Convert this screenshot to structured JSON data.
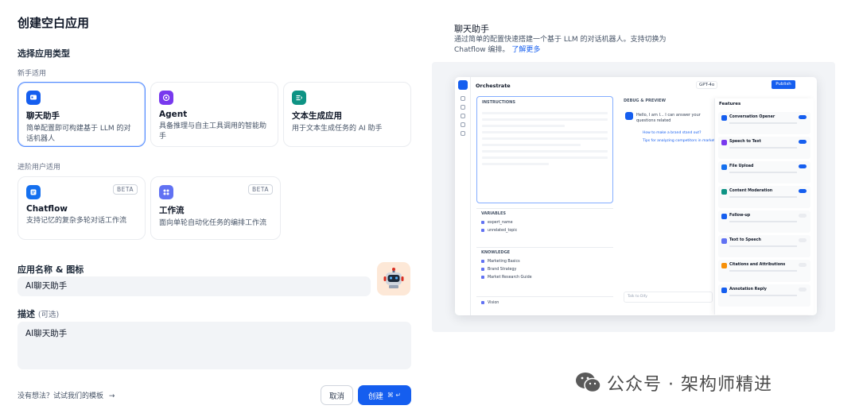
{
  "page": {
    "title": "创建空白应用"
  },
  "app_type": {
    "section_title": "选择应用类型",
    "beginner_label": "新手适用",
    "advanced_label": "进阶用户适用",
    "beginner_cards": [
      {
        "title": "聊天助手",
        "desc": "简单配置即可构建基于 LLM 的对话机器人",
        "color": "#155eef",
        "icon": "chat-bubble-icon",
        "selected": true
      },
      {
        "title": "Agent",
        "desc": "具备推理与自主工具调用的智能助手",
        "color": "#7839ee",
        "icon": "robot-icon",
        "selected": false
      },
      {
        "title": "文本生成应用",
        "desc": "用于文本生成任务的 AI 助手",
        "color": "#0e9384",
        "icon": "text-generate-icon",
        "selected": false
      }
    ],
    "advanced_cards": [
      {
        "title": "Chatflow",
        "desc": "支持记忆的复杂多轮对话工作流",
        "badge": "BETA",
        "color": "#1570ef",
        "icon": "chatflow-icon"
      },
      {
        "title": "工作流",
        "desc": "面向单轮自动化任务的编排工作流",
        "badge": "BETA",
        "color": "#6172f3",
        "icon": "workflow-icon"
      }
    ]
  },
  "form": {
    "name_label": "应用名称 & 图标",
    "name_value": "AI聊天助手",
    "desc_label": "描述",
    "desc_optional": "(可选)",
    "desc_value": "AI聊天助手"
  },
  "footer": {
    "hint": "没有想法？试试我们的模板",
    "hint_arrow": "→",
    "cancel_label": "取消",
    "create_label": "创建",
    "create_shortcut": "⌘ ↵"
  },
  "preview": {
    "title": "聊天助手",
    "desc": "通过简单的配置快速搭建一个基于 LLM 的对话机器人。支持切换为 Chatflow 编排。",
    "learn_more": "了解更多",
    "window": {
      "title": "Orchestrate",
      "model": "GPT-4o",
      "publish": "Publish",
      "instructions": "INSTRUCTIONS",
      "debug": "DEBUG & PREVIEW",
      "variables": "VARIABLES",
      "knowledge": "KNOWLEDGE",
      "variable_rows": [
        "expert_name",
        "unrelated_topic"
      ],
      "knowledge_rows": [
        "Marketing Basics",
        "Brand Strategy",
        "Market Research Guide"
      ],
      "vision": "Vision",
      "chat_greeting": "Hello, I am I...\nI can answer your questions related",
      "suggestions": [
        "How to make a brand stand out?",
        "Tips for analyzing competitors in market"
      ],
      "chat_placeholder": "Talk to Dify",
      "features_title": "Features",
      "features": [
        {
          "name": "Conversation Opener",
          "on": true,
          "color": "#155eef"
        },
        {
          "name": "Speech to Text",
          "on": true,
          "color": "#7839ee"
        },
        {
          "name": "File Upload",
          "on": true,
          "color": "#1570ef"
        },
        {
          "name": "Content Moderation",
          "on": true,
          "color": "#0e9384"
        },
        {
          "name": "Follow-up",
          "on": false,
          "color": "#155eef"
        },
        {
          "name": "Text to Speech",
          "on": false,
          "color": "#6172f3"
        },
        {
          "name": "Citations and Attributions",
          "on": false,
          "color": "#f79009"
        },
        {
          "name": "Annotation Reply",
          "on": false,
          "color": "#155eef"
        }
      ]
    }
  },
  "watermark": {
    "text": "公众号 · 架构师精进"
  }
}
